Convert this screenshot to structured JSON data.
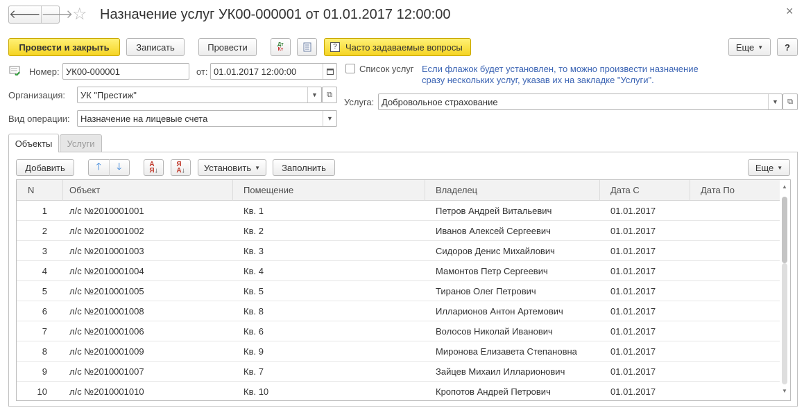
{
  "window": {
    "title": "Назначение услуг УК00-000001 от 01.01.2017 12:00:00",
    "back_glyph": "🡐",
    "forward_glyph": "🡒",
    "star_glyph": "☆",
    "close_glyph": "×"
  },
  "toolbar": {
    "post_close": "Провести и закрыть",
    "save": "Записать",
    "post": "Провести",
    "dt_kt_icon": "dt-kt-icon",
    "report_icon": "document-icon",
    "faq_icon_glyph": "?",
    "faq": "Часто задаваемые вопросы",
    "more": "Еще",
    "help": "?"
  },
  "header": {
    "number_label": "Номер:",
    "number_value": "УК00-000001",
    "date_label": "от:",
    "date_value": "01.01.2017 12:00:00",
    "org_label": "Организация:",
    "org_value": "УК \"Престиж\"",
    "op_label": "Вид операции:",
    "op_value": "Назначение на лицевые счета",
    "services_list_label": "Список услуг",
    "services_list_checked": false,
    "hint": "Если флажок будет установлен, то можно произвести назначение сразу нескольких услуг, указав их на закладке \"Услуги\".",
    "service_label": "Услуга:",
    "service_value": "Добровольное страхование"
  },
  "tabs": [
    {
      "label": "Объекты",
      "active": true
    },
    {
      "label": "Услуги",
      "active": false
    }
  ],
  "table_toolbar": {
    "add": "Добавить",
    "move_up_glyph": "🡑",
    "move_down_glyph": "🡓",
    "set": "Установить",
    "fill": "Заполнить",
    "more": "Еще"
  },
  "table": {
    "columns": [
      "N",
      "Объект",
      "Помещение",
      "Владелец",
      "Дата С",
      "Дата По"
    ],
    "rows": [
      [
        "1",
        "л/с №2010001001",
        "Кв. 1",
        "Петров Андрей Витальевич",
        "01.01.2017",
        ""
      ],
      [
        "2",
        "л/с №2010001002",
        "Кв. 2",
        "Иванов Алексей Сергеевич",
        "01.01.2017",
        ""
      ],
      [
        "3",
        "л/с №2010001003",
        "Кв. 3",
        "Сидоров Денис Михайлович",
        "01.01.2017",
        ""
      ],
      [
        "4",
        "л/с №2010001004",
        "Кв. 4",
        "Мамонтов Петр Сергеевич",
        "01.01.2017",
        ""
      ],
      [
        "5",
        "л/с №2010001005",
        "Кв. 5",
        "Тиранов Олег Петрович",
        "01.01.2017",
        ""
      ],
      [
        "6",
        "л/с №2010001008",
        "Кв. 8",
        "Илларионов Антон Артемович",
        "01.01.2017",
        ""
      ],
      [
        "7",
        "л/с №2010001006",
        "Кв. 6",
        "Волосов Николай Иванович",
        "01.01.2017",
        ""
      ],
      [
        "8",
        "л/с №2010001009",
        "Кв. 9",
        "Миронова Елизавета Степановна",
        "01.01.2017",
        ""
      ],
      [
        "9",
        "л/с №2010001007",
        "Кв. 7",
        "Зайцев Михаил Илларионович",
        "01.01.2017",
        ""
      ],
      [
        "10",
        "л/с №2010001010",
        "Кв. 10",
        "Кропотов Андрей Петрович",
        "01.01.2017",
        ""
      ]
    ]
  },
  "colors": {
    "accent_yellow": "#f5d423",
    "hint_blue": "#3b64b4",
    "arrow_blue": "#2f7ed8"
  }
}
